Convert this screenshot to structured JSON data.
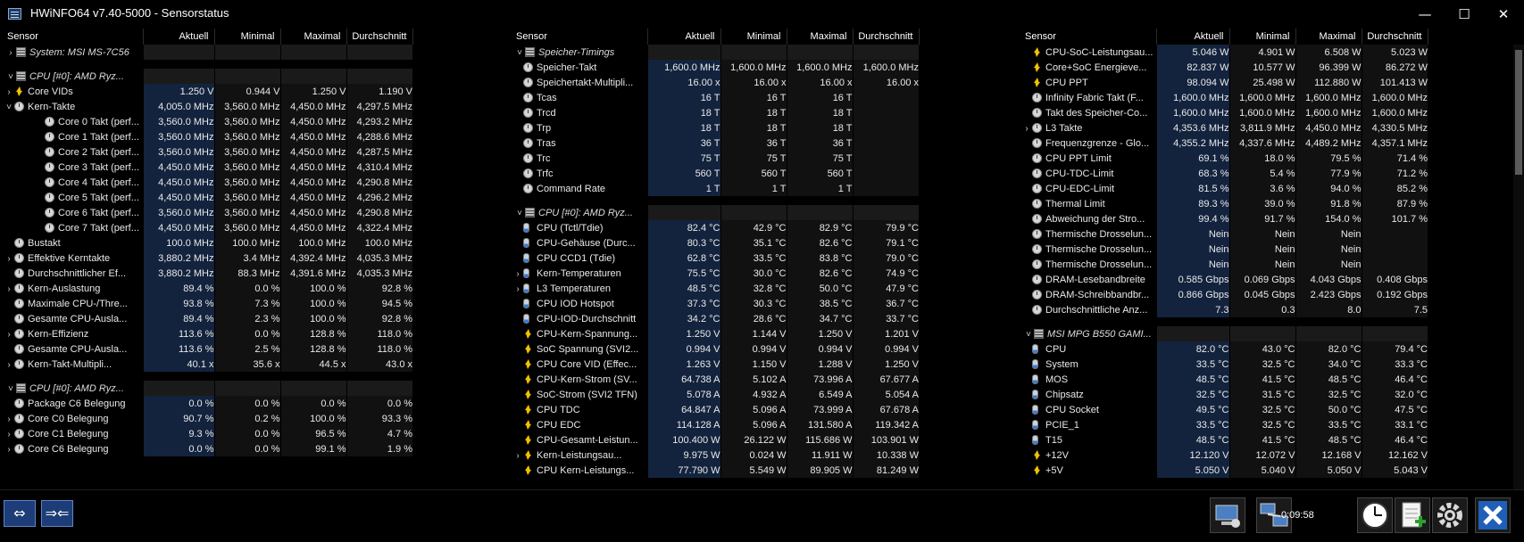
{
  "window": {
    "title": "HWiNFO64 v7.40-5000 - Sensorstatus",
    "minimize": "—",
    "maximize": "☐",
    "close": "✕"
  },
  "columns": {
    "sensor": "Sensor",
    "current": "Aktuell",
    "min": "Minimal",
    "max": "Maximal",
    "avg": "Durchschnitt"
  },
  "panes": [
    {
      "rows": [
        {
          "t": "group",
          "exp": ">",
          "icon": "chip",
          "name": "System: MSI MS-7C56"
        },
        {
          "t": "sep"
        },
        {
          "t": "group",
          "exp": "v",
          "icon": "chip",
          "name": "CPU [#0]: AMD Ryz..."
        },
        {
          "level": 1,
          "exp": ">",
          "icon": "bolt",
          "name": "Core VIDs",
          "v": [
            "1.250 V",
            "0.944 V",
            "1.250 V",
            "1.190 V"
          ]
        },
        {
          "level": 1,
          "exp": "v",
          "icon": "clock",
          "name": "Kern-Takte",
          "v": [
            "4,005.0 MHz",
            "3,560.0 MHz",
            "4,450.0 MHz",
            "4,297.5 MHz"
          ]
        },
        {
          "level": 2,
          "icon": "clock",
          "name": "Core 0 Takt (perf...",
          "v": [
            "3,560.0 MHz",
            "3,560.0 MHz",
            "4,450.0 MHz",
            "4,293.2 MHz"
          ]
        },
        {
          "level": 2,
          "icon": "clock",
          "name": "Core 1 Takt (perf...",
          "v": [
            "3,560.0 MHz",
            "3,560.0 MHz",
            "4,450.0 MHz",
            "4,288.6 MHz"
          ]
        },
        {
          "level": 2,
          "icon": "clock",
          "name": "Core 2 Takt (perf...",
          "v": [
            "3,560.0 MHz",
            "3,560.0 MHz",
            "4,450.0 MHz",
            "4,287.5 MHz"
          ]
        },
        {
          "level": 2,
          "icon": "clock",
          "name": "Core 3 Takt (perf...",
          "v": [
            "4,450.0 MHz",
            "3,560.0 MHz",
            "4,450.0 MHz",
            "4,310.4 MHz"
          ]
        },
        {
          "level": 2,
          "icon": "clock",
          "name": "Core 4 Takt (perf...",
          "v": [
            "4,450.0 MHz",
            "3,560.0 MHz",
            "4,450.0 MHz",
            "4,290.8 MHz"
          ]
        },
        {
          "level": 2,
          "icon": "clock",
          "name": "Core 5 Takt (perf...",
          "v": [
            "4,450.0 MHz",
            "3,560.0 MHz",
            "4,450.0 MHz",
            "4,296.2 MHz"
          ]
        },
        {
          "level": 2,
          "icon": "clock",
          "name": "Core 6 Takt (perf...",
          "v": [
            "3,560.0 MHz",
            "3,560.0 MHz",
            "4,450.0 MHz",
            "4,290.8 MHz"
          ]
        },
        {
          "level": 2,
          "icon": "clock",
          "name": "Core 7 Takt (perf...",
          "v": [
            "4,450.0 MHz",
            "3,560.0 MHz",
            "4,450.0 MHz",
            "4,322.4 MHz"
          ]
        },
        {
          "level": 1,
          "icon": "clock",
          "name": "Bustakt",
          "v": [
            "100.0 MHz",
            "100.0 MHz",
            "100.0 MHz",
            "100.0 MHz"
          ]
        },
        {
          "level": 1,
          "exp": ">",
          "icon": "clock",
          "name": "Effektive Kerntakte",
          "v": [
            "3,880.2 MHz",
            "3.4 MHz",
            "4,392.4 MHz",
            "4,035.3 MHz"
          ]
        },
        {
          "level": 1,
          "icon": "clock",
          "name": "Durchschnittlicher Ef...",
          "v": [
            "3,880.2 MHz",
            "88.3 MHz",
            "4,391.6 MHz",
            "4,035.3 MHz"
          ]
        },
        {
          "level": 1,
          "exp": ">",
          "icon": "clock",
          "name": "Kern-Auslastung",
          "v": [
            "89.4 %",
            "0.0 %",
            "100.0 %",
            "92.8 %"
          ]
        },
        {
          "level": 1,
          "icon": "clock",
          "name": "Maximale CPU-/Thre...",
          "v": [
            "93.8 %",
            "7.3 %",
            "100.0 %",
            "94.5 %"
          ]
        },
        {
          "level": 1,
          "icon": "clock",
          "name": "Gesamte CPU-Ausla...",
          "v": [
            "89.4 %",
            "2.3 %",
            "100.0 %",
            "92.8 %"
          ]
        },
        {
          "level": 1,
          "exp": ">",
          "icon": "clock",
          "name": "Kern-Effizienz",
          "v": [
            "113.6 %",
            "0.0 %",
            "128.8 %",
            "118.0 %"
          ]
        },
        {
          "level": 1,
          "icon": "clock",
          "name": "Gesamte CPU-Ausla...",
          "v": [
            "113.6 %",
            "2.5 %",
            "128.8 %",
            "118.0 %"
          ]
        },
        {
          "level": 1,
          "exp": ">",
          "icon": "clock",
          "name": "Kern-Takt-Multipli...",
          "v": [
            "40.1 x",
            "35.6 x",
            "44.5 x",
            "43.0 x"
          ]
        },
        {
          "t": "sep"
        },
        {
          "t": "group",
          "exp": "v",
          "icon": "chip",
          "name": "CPU [#0]: AMD Ryz..."
        },
        {
          "level": 1,
          "icon": "clock",
          "name": "Package C6 Belegung",
          "v": [
            "0.0 %",
            "0.0 %",
            "0.0 %",
            "0.0 %"
          ]
        },
        {
          "level": 1,
          "exp": ">",
          "icon": "clock",
          "name": "Core C0 Belegung",
          "v": [
            "90.7 %",
            "0.2 %",
            "100.0 %",
            "93.3 %"
          ]
        },
        {
          "level": 1,
          "exp": ">",
          "icon": "clock",
          "name": "Core C1 Belegung",
          "v": [
            "9.3 %",
            "0.0 %",
            "96.5 %",
            "4.7 %"
          ]
        },
        {
          "level": 1,
          "exp": ">",
          "icon": "clock",
          "name": "Core C6 Belegung",
          "v": [
            "0.0 %",
            "0.0 %",
            "99.1 %",
            "1.9 %"
          ]
        }
      ]
    },
    {
      "rows": [
        {
          "t": "group",
          "exp": "v",
          "icon": "chip",
          "name": "Speicher-Timings"
        },
        {
          "level": 1,
          "icon": "clock",
          "name": "Speicher-Takt",
          "v": [
            "1,600.0 MHz",
            "1,600.0 MHz",
            "1,600.0 MHz",
            "1,600.0 MHz"
          ]
        },
        {
          "level": 1,
          "icon": "clock",
          "name": "Speichertakt-Multipli...",
          "v": [
            "16.00 x",
            "16.00 x",
            "16.00 x",
            "16.00 x"
          ]
        },
        {
          "level": 1,
          "icon": "clock",
          "name": "Tcas",
          "v": [
            "16 T",
            "16 T",
            "16 T",
            ""
          ]
        },
        {
          "level": 1,
          "icon": "clock",
          "name": "Trcd",
          "v": [
            "18 T",
            "18 T",
            "18 T",
            ""
          ]
        },
        {
          "level": 1,
          "icon": "clock",
          "name": "Trp",
          "v": [
            "18 T",
            "18 T",
            "18 T",
            ""
          ]
        },
        {
          "level": 1,
          "icon": "clock",
          "name": "Tras",
          "v": [
            "36 T",
            "36 T",
            "36 T",
            ""
          ]
        },
        {
          "level": 1,
          "icon": "clock",
          "name": "Trc",
          "v": [
            "75 T",
            "75 T",
            "75 T",
            ""
          ]
        },
        {
          "level": 1,
          "icon": "clock",
          "name": "Trfc",
          "v": [
            "560 T",
            "560 T",
            "560 T",
            ""
          ]
        },
        {
          "level": 1,
          "icon": "clock",
          "name": "Command Rate",
          "v": [
            "1 T",
            "1 T",
            "1 T",
            ""
          ]
        },
        {
          "t": "sep"
        },
        {
          "t": "group",
          "exp": "v",
          "icon": "chip",
          "name": "CPU [#0]: AMD Ryz..."
        },
        {
          "level": 1,
          "icon": "therm",
          "name": "CPU (Tctl/Tdie)",
          "v": [
            "82.4 °C",
            "42.9 °C",
            "82.9 °C",
            "79.9 °C"
          ]
        },
        {
          "level": 1,
          "icon": "therm",
          "name": "CPU-Gehäuse (Durc...",
          "v": [
            "80.3 °C",
            "35.1 °C",
            "82.6 °C",
            "79.1 °C"
          ]
        },
        {
          "level": 1,
          "icon": "therm",
          "name": "CPU CCD1 (Tdie)",
          "v": [
            "62.8 °C",
            "33.5 °C",
            "83.8 °C",
            "79.0 °C"
          ]
        },
        {
          "level": 1,
          "exp": ">",
          "icon": "therm",
          "name": "Kern-Temperaturen",
          "v": [
            "75.5 °C",
            "30.0 °C",
            "82.6 °C",
            "74.9 °C"
          ]
        },
        {
          "level": 1,
          "exp": ">",
          "icon": "therm",
          "name": "L3 Temperaturen",
          "v": [
            "48.5 °C",
            "32.8 °C",
            "50.0 °C",
            "47.9 °C"
          ]
        },
        {
          "level": 1,
          "icon": "therm",
          "name": "CPU IOD Hotspot",
          "v": [
            "37.3 °C",
            "30.3 °C",
            "38.5 °C",
            "36.7 °C"
          ]
        },
        {
          "level": 1,
          "icon": "therm",
          "name": "CPU-IOD-Durchschnitt",
          "v": [
            "34.2 °C",
            "28.6 °C",
            "34.7 °C",
            "33.7 °C"
          ]
        },
        {
          "level": 1,
          "icon": "bolt",
          "name": "CPU-Kern-Spannung...",
          "v": [
            "1.250 V",
            "1.144 V",
            "1.250 V",
            "1.201 V"
          ]
        },
        {
          "level": 1,
          "icon": "bolt",
          "name": "SoC Spannung (SVI2...",
          "v": [
            "0.994 V",
            "0.994 V",
            "0.994 V",
            "0.994 V"
          ]
        },
        {
          "level": 1,
          "icon": "bolt",
          "name": "CPU Core VID (Effec...",
          "v": [
            "1.263 V",
            "1.150 V",
            "1.288 V",
            "1.250 V"
          ]
        },
        {
          "level": 1,
          "icon": "bolt",
          "name": "CPU-Kern-Strom (SV...",
          "v": [
            "64.738 A",
            "5.102 A",
            "73.996 A",
            "67.677 A"
          ]
        },
        {
          "level": 1,
          "icon": "bolt",
          "name": "SoC-Strom (SVI2 TFN)",
          "v": [
            "5.078 A",
            "4.932 A",
            "6.549 A",
            "5.054 A"
          ]
        },
        {
          "level": 1,
          "icon": "bolt",
          "name": "CPU TDC",
          "v": [
            "64.847 A",
            "5.096 A",
            "73.999 A",
            "67.678 A"
          ]
        },
        {
          "level": 1,
          "icon": "bolt",
          "name": "CPU EDC",
          "v": [
            "114.128 A",
            "5.096 A",
            "131.580 A",
            "119.342 A"
          ]
        },
        {
          "level": 1,
          "icon": "bolt",
          "name": "CPU-Gesamt-Leistun...",
          "v": [
            "100.400 W",
            "26.122 W",
            "115.686 W",
            "103.901 W"
          ]
        },
        {
          "level": 1,
          "exp": ">",
          "icon": "bolt",
          "name": "Kern-Leistungsau...",
          "v": [
            "9.975 W",
            "0.024 W",
            "11.911 W",
            "10.338 W"
          ]
        },
        {
          "level": 1,
          "icon": "bolt",
          "name": "CPU Kern-Leistungs...",
          "v": [
            "77.790 W",
            "5.549 W",
            "89.905 W",
            "81.249 W"
          ]
        }
      ]
    },
    {
      "rows": [
        {
          "level": 1,
          "icon": "bolt",
          "name": "CPU-SoC-Leistungsau...",
          "v": [
            "5.046 W",
            "4.901 W",
            "6.508 W",
            "5.023 W"
          ]
        },
        {
          "level": 1,
          "icon": "bolt",
          "name": "Core+SoC Energieve...",
          "v": [
            "82.837 W",
            "10.577 W",
            "96.399 W",
            "86.272 W"
          ]
        },
        {
          "level": 1,
          "icon": "bolt",
          "name": "CPU PPT",
          "v": [
            "98.094 W",
            "25.498 W",
            "112.880 W",
            "101.413 W"
          ]
        },
        {
          "level": 1,
          "icon": "clock",
          "name": "Infinity Fabric Takt (F...",
          "v": [
            "1,600.0 MHz",
            "1,600.0 MHz",
            "1,600.0 MHz",
            "1,600.0 MHz"
          ]
        },
        {
          "level": 1,
          "icon": "clock",
          "name": "Takt des Speicher-Co...",
          "v": [
            "1,600.0 MHz",
            "1,600.0 MHz",
            "1,600.0 MHz",
            "1,600.0 MHz"
          ]
        },
        {
          "level": 1,
          "exp": ">",
          "icon": "clock",
          "name": "L3 Takte",
          "v": [
            "4,353.6 MHz",
            "3,811.9 MHz",
            "4,450.0 MHz",
            "4,330.5 MHz"
          ]
        },
        {
          "level": 1,
          "icon": "clock",
          "name": "Frequenzgrenze - Glo...",
          "v": [
            "4,355.2 MHz",
            "4,337.6 MHz",
            "4,489.2 MHz",
            "4,357.1 MHz"
          ]
        },
        {
          "level": 1,
          "icon": "clock",
          "name": "CPU PPT Limit",
          "v": [
            "69.1 %",
            "18.0 %",
            "79.5 %",
            "71.4 %"
          ]
        },
        {
          "level": 1,
          "icon": "clock",
          "name": "CPU-TDC-Limit",
          "v": [
            "68.3 %",
            "5.4 %",
            "77.9 %",
            "71.2 %"
          ]
        },
        {
          "level": 1,
          "icon": "clock",
          "name": "CPU-EDC-Limit",
          "v": [
            "81.5 %",
            "3.6 %",
            "94.0 %",
            "85.2 %"
          ]
        },
        {
          "level": 1,
          "icon": "clock",
          "name": "Thermal Limit",
          "v": [
            "89.3 %",
            "39.0 %",
            "91.8 %",
            "87.9 %"
          ]
        },
        {
          "level": 1,
          "icon": "clock",
          "name": "Abweichung der Stro...",
          "v": [
            "99.4 %",
            "91.7 %",
            "154.0 %",
            "101.7 %"
          ]
        },
        {
          "level": 1,
          "icon": "clock",
          "name": "Thermische Drosselun...",
          "v": [
            "Nein",
            "Nein",
            "Nein",
            ""
          ]
        },
        {
          "level": 1,
          "icon": "clock",
          "name": "Thermische Drosselun...",
          "v": [
            "Nein",
            "Nein",
            "Nein",
            ""
          ]
        },
        {
          "level": 1,
          "icon": "clock",
          "name": "Thermische Drosselun...",
          "v": [
            "Nein",
            "Nein",
            "Nein",
            ""
          ]
        },
        {
          "level": 1,
          "icon": "clock",
          "name": "DRAM-Lesebandbreite",
          "v": [
            "0.585 Gbps",
            "0.069 Gbps",
            "4.043 Gbps",
            "0.408 Gbps"
          ]
        },
        {
          "level": 1,
          "icon": "clock",
          "name": "DRAM-Schreibbandbr...",
          "v": [
            "0.866 Gbps",
            "0.045 Gbps",
            "2.423 Gbps",
            "0.192 Gbps"
          ]
        },
        {
          "level": 1,
          "icon": "clock",
          "name": "Durchschnittliche Anz...",
          "v": [
            "7.3",
            "0.3",
            "8.0",
            "7.5"
          ]
        },
        {
          "t": "sep"
        },
        {
          "t": "group",
          "exp": "v",
          "icon": "chip",
          "name": "MSI MPG B550 GAMI..."
        },
        {
          "level": 1,
          "icon": "therm",
          "name": "CPU",
          "v": [
            "82.0 °C",
            "43.0 °C",
            "82.0 °C",
            "79.4 °C"
          ]
        },
        {
          "level": 1,
          "icon": "therm",
          "name": "System",
          "v": [
            "33.5 °C",
            "32.5 °C",
            "34.0 °C",
            "33.3 °C"
          ]
        },
        {
          "level": 1,
          "icon": "therm",
          "name": "MOS",
          "v": [
            "48.5 °C",
            "41.5 °C",
            "48.5 °C",
            "46.4 °C"
          ]
        },
        {
          "level": 1,
          "icon": "therm",
          "name": "Chipsatz",
          "v": [
            "32.5 °C",
            "31.5 °C",
            "32.5 °C",
            "32.0 °C"
          ]
        },
        {
          "level": 1,
          "icon": "therm",
          "name": "CPU Socket",
          "v": [
            "49.5 °C",
            "32.5 °C",
            "50.0 °C",
            "47.5 °C"
          ]
        },
        {
          "level": 1,
          "icon": "therm",
          "name": "PCIE_1",
          "v": [
            "33.5 °C",
            "32.5 °C",
            "33.5 °C",
            "33.1 °C"
          ]
        },
        {
          "level": 1,
          "icon": "therm",
          "name": "T15",
          "v": [
            "48.5 °C",
            "41.5 °C",
            "48.5 °C",
            "46.4 °C"
          ]
        },
        {
          "level": 1,
          "icon": "bolt",
          "name": "+12V",
          "v": [
            "12.120 V",
            "12.072 V",
            "12.168 V",
            "12.162 V"
          ]
        },
        {
          "level": 1,
          "icon": "bolt",
          "name": "+5V",
          "v": [
            "5.050 V",
            "5.040 V",
            "5.050 V",
            "5.043 V"
          ]
        }
      ]
    }
  ],
  "bottom": {
    "elapsed": "0:09:58",
    "nav_left": "⇔",
    "nav_right": "⇒⇐",
    "icons": [
      "network-icon",
      "network-status-icon",
      "clock-reset-icon",
      "report-add-icon",
      "settings-gear-icon",
      "close-x-icon"
    ]
  }
}
